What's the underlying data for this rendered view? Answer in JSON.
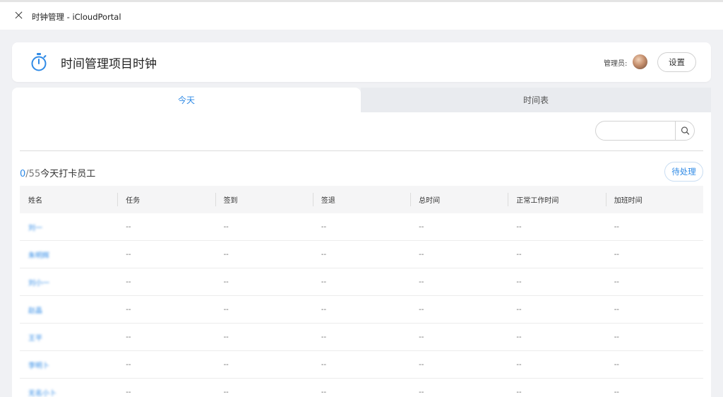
{
  "window": {
    "title": "时钟管理 - iCloudPortal",
    "close_icon": "close-icon"
  },
  "header": {
    "app_icon": "stopwatch-icon",
    "title": "时间管理项目时钟",
    "admin_label": "管理员:",
    "settings_label": "设置"
  },
  "tabs": [
    {
      "label": "今天",
      "active": true
    },
    {
      "label": "时间表",
      "active": false
    }
  ],
  "search": {
    "placeholder": "",
    "icon": "search-icon"
  },
  "summary": {
    "clocked_in": "0",
    "separator": "/",
    "total": "55",
    "label": "今天打卡员工"
  },
  "pending_button": "待处理",
  "table": {
    "columns": [
      "姓名",
      "任务",
      "签到",
      "签退",
      "总时间",
      "正常工作时间",
      "加班时间"
    ],
    "rows": [
      {
        "name": "刘一",
        "task": "--",
        "sign_in": "--",
        "sign_out": "--",
        "total": "--",
        "regular": "--",
        "overtime": "--"
      },
      {
        "name": "朱明辉",
        "task": "--",
        "sign_in": "--",
        "sign_out": "--",
        "total": "--",
        "regular": "--",
        "overtime": "--"
      },
      {
        "name": "刘小一",
        "task": "--",
        "sign_in": "--",
        "sign_out": "--",
        "total": "--",
        "regular": "--",
        "overtime": "--"
      },
      {
        "name": "赵晶",
        "task": "--",
        "sign_in": "--",
        "sign_out": "--",
        "total": "--",
        "regular": "--",
        "overtime": "--"
      },
      {
        "name": "王平",
        "task": "--",
        "sign_in": "--",
        "sign_out": "--",
        "total": "--",
        "regular": "--",
        "overtime": "--"
      },
      {
        "name": "李明卜",
        "task": "--",
        "sign_in": "--",
        "sign_out": "--",
        "total": "--",
        "regular": "--",
        "overtime": "--"
      },
      {
        "name": "无名小卜",
        "task": "--",
        "sign_in": "--",
        "sign_out": "--",
        "total": "--",
        "regular": "--",
        "overtime": "--"
      }
    ]
  },
  "colors": {
    "accent": "#2f8ae6",
    "page_bg": "#f0f1f4",
    "header_bg": "#f5f5f6"
  }
}
